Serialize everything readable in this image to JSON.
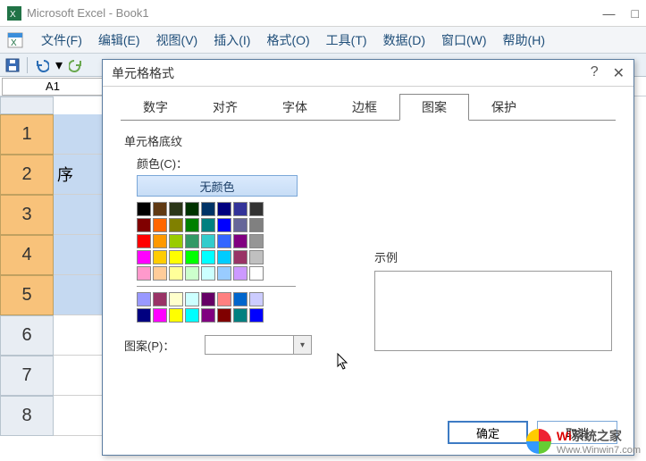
{
  "app": {
    "title": "Microsoft Excel - Book1"
  },
  "menubar": {
    "file": "文件(F)",
    "edit": "编辑(E)",
    "view": "视图(V)",
    "insert": "插入(I)",
    "format": "格式(O)",
    "tools": "工具(T)",
    "data": "数据(D)",
    "window": "窗口(W)",
    "help": "帮助(H)"
  },
  "namebox": {
    "value": "A1"
  },
  "rows": {
    "1": "1",
    "2": "2",
    "3": "3",
    "4": "4",
    "5": "5",
    "6": "6",
    "7": "7",
    "8": "8"
  },
  "cells": {
    "a2": "序"
  },
  "dialog": {
    "title": "单元格格式",
    "tabs": {
      "number": "数字",
      "align": "对齐",
      "font": "字体",
      "border": "边框",
      "pattern": "图案",
      "protect": "保护"
    },
    "group_title": "单元格底纹",
    "color_label": "颜色(C)：",
    "no_color": "无颜色",
    "pattern_label": "图案(P)：",
    "sample_label": "示例",
    "ok": "确定",
    "cancel": "取消",
    "palette_main": [
      [
        "#000000",
        "#603913",
        "#2b3618",
        "#003300",
        "#003366",
        "#000080",
        "#333399",
        "#333333"
      ],
      [
        "#800000",
        "#ff6600",
        "#808000",
        "#008000",
        "#008080",
        "#0000ff",
        "#666699",
        "#808080"
      ],
      [
        "#ff0000",
        "#ff9900",
        "#99cc00",
        "#339966",
        "#33cccc",
        "#3366ff",
        "#800080",
        "#969696"
      ],
      [
        "#ff00ff",
        "#ffcc00",
        "#ffff00",
        "#00ff00",
        "#00ffff",
        "#00ccff",
        "#993366",
        "#c0c0c0"
      ],
      [
        "#ff99cc",
        "#ffcc99",
        "#ffff99",
        "#ccffcc",
        "#ccffff",
        "#99ccff",
        "#cc99ff",
        "#ffffff"
      ]
    ],
    "palette_extra": [
      [
        "#9999ff",
        "#993366",
        "#ffffcc",
        "#ccffff",
        "#660066",
        "#ff8080",
        "#0066cc",
        "#ccccff"
      ],
      [
        "#000080",
        "#ff00ff",
        "#ffff00",
        "#00ffff",
        "#800080",
        "#800000",
        "#008080",
        "#0000ff"
      ]
    ]
  },
  "watermark": {
    "brand_prefix": "Wi",
    "brand_suffix": "系统之家",
    "url": "Www.Winwin7.com"
  }
}
